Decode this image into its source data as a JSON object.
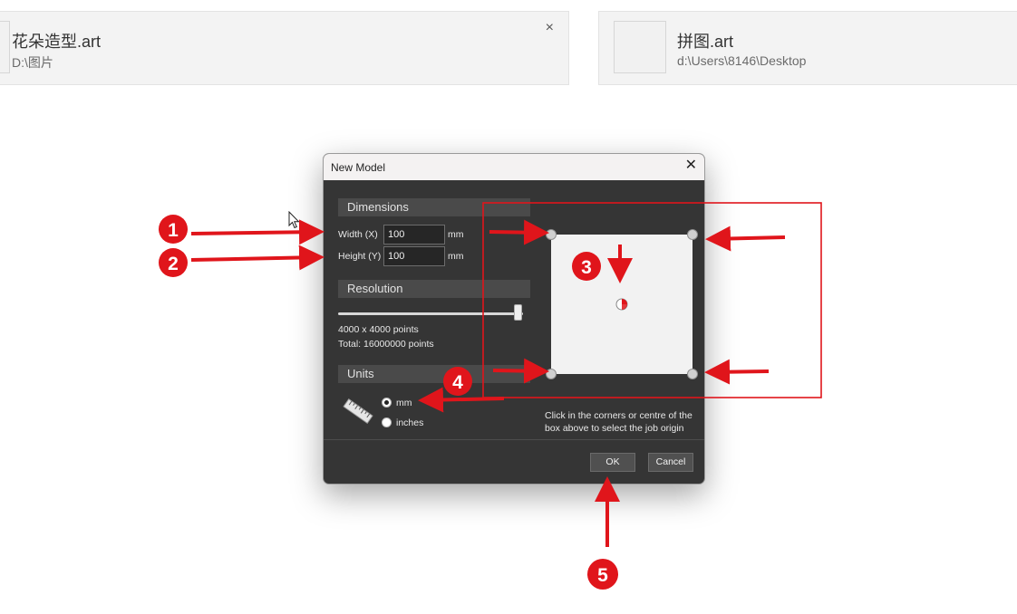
{
  "recent_files": [
    {
      "name": "花朵造型.art",
      "path": "D:\\图片",
      "close": "×"
    },
    {
      "name": "拼图.art",
      "path": "d:\\Users\\8146\\Desktop"
    }
  ],
  "dialog": {
    "title": "New Model",
    "close": "✕",
    "dimensions": {
      "header": "Dimensions",
      "width_label": "Width (X)",
      "width_value": "100",
      "width_unit": "mm",
      "height_label": "Height (Y)",
      "height_value": "100",
      "height_unit": "mm"
    },
    "resolution": {
      "header": "Resolution",
      "slider_level": 1.0,
      "points": "4000 x 4000 points",
      "total": "Total: 16000000 points"
    },
    "units": {
      "header": "Units",
      "options": [
        "mm",
        "inches"
      ],
      "selected": "mm"
    },
    "origin_hint": "Click in the corners or centre of the box above to select the job origin",
    "ok": "OK",
    "cancel": "Cancel"
  },
  "annotations": {
    "steps": [
      "1",
      "2",
      "3",
      "4",
      "5"
    ],
    "color": "#e0151b"
  }
}
